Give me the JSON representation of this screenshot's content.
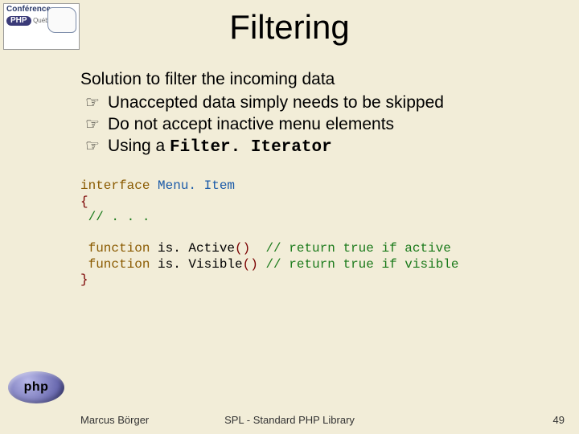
{
  "title": "Filtering",
  "intro": "Solution to filter the incoming data",
  "bullet_glyph": "☞",
  "bullets": [
    {
      "text": "Unaccepted data simply needs to be skipped"
    },
    {
      "text": "Do not accept inactive menu elements"
    },
    {
      "prefix": "Using a ",
      "mono": "Filter. Iterator"
    }
  ],
  "code": {
    "l1_kw": "interface ",
    "l1_cls": "Menu. Item",
    "l2_op": "{",
    "l3_cmt": " // . . .",
    "blank": "",
    "l5_kw": " function ",
    "l5_name": "is. Active",
    "l5_op1": "()  ",
    "l5_cmt": "// return true if active",
    "l6_kw": " function ",
    "l6_name": "is. Visible",
    "l6_op1": "() ",
    "l6_cmt": "// return true if visible",
    "l7_op": "}"
  },
  "logos": {
    "top_conf": "Conférence",
    "top_php": "PHP",
    "top_loc": "Québec",
    "bottom": "php"
  },
  "footer": {
    "author": "Marcus Börger",
    "center": "SPL - Standard PHP Library",
    "page": "49"
  }
}
